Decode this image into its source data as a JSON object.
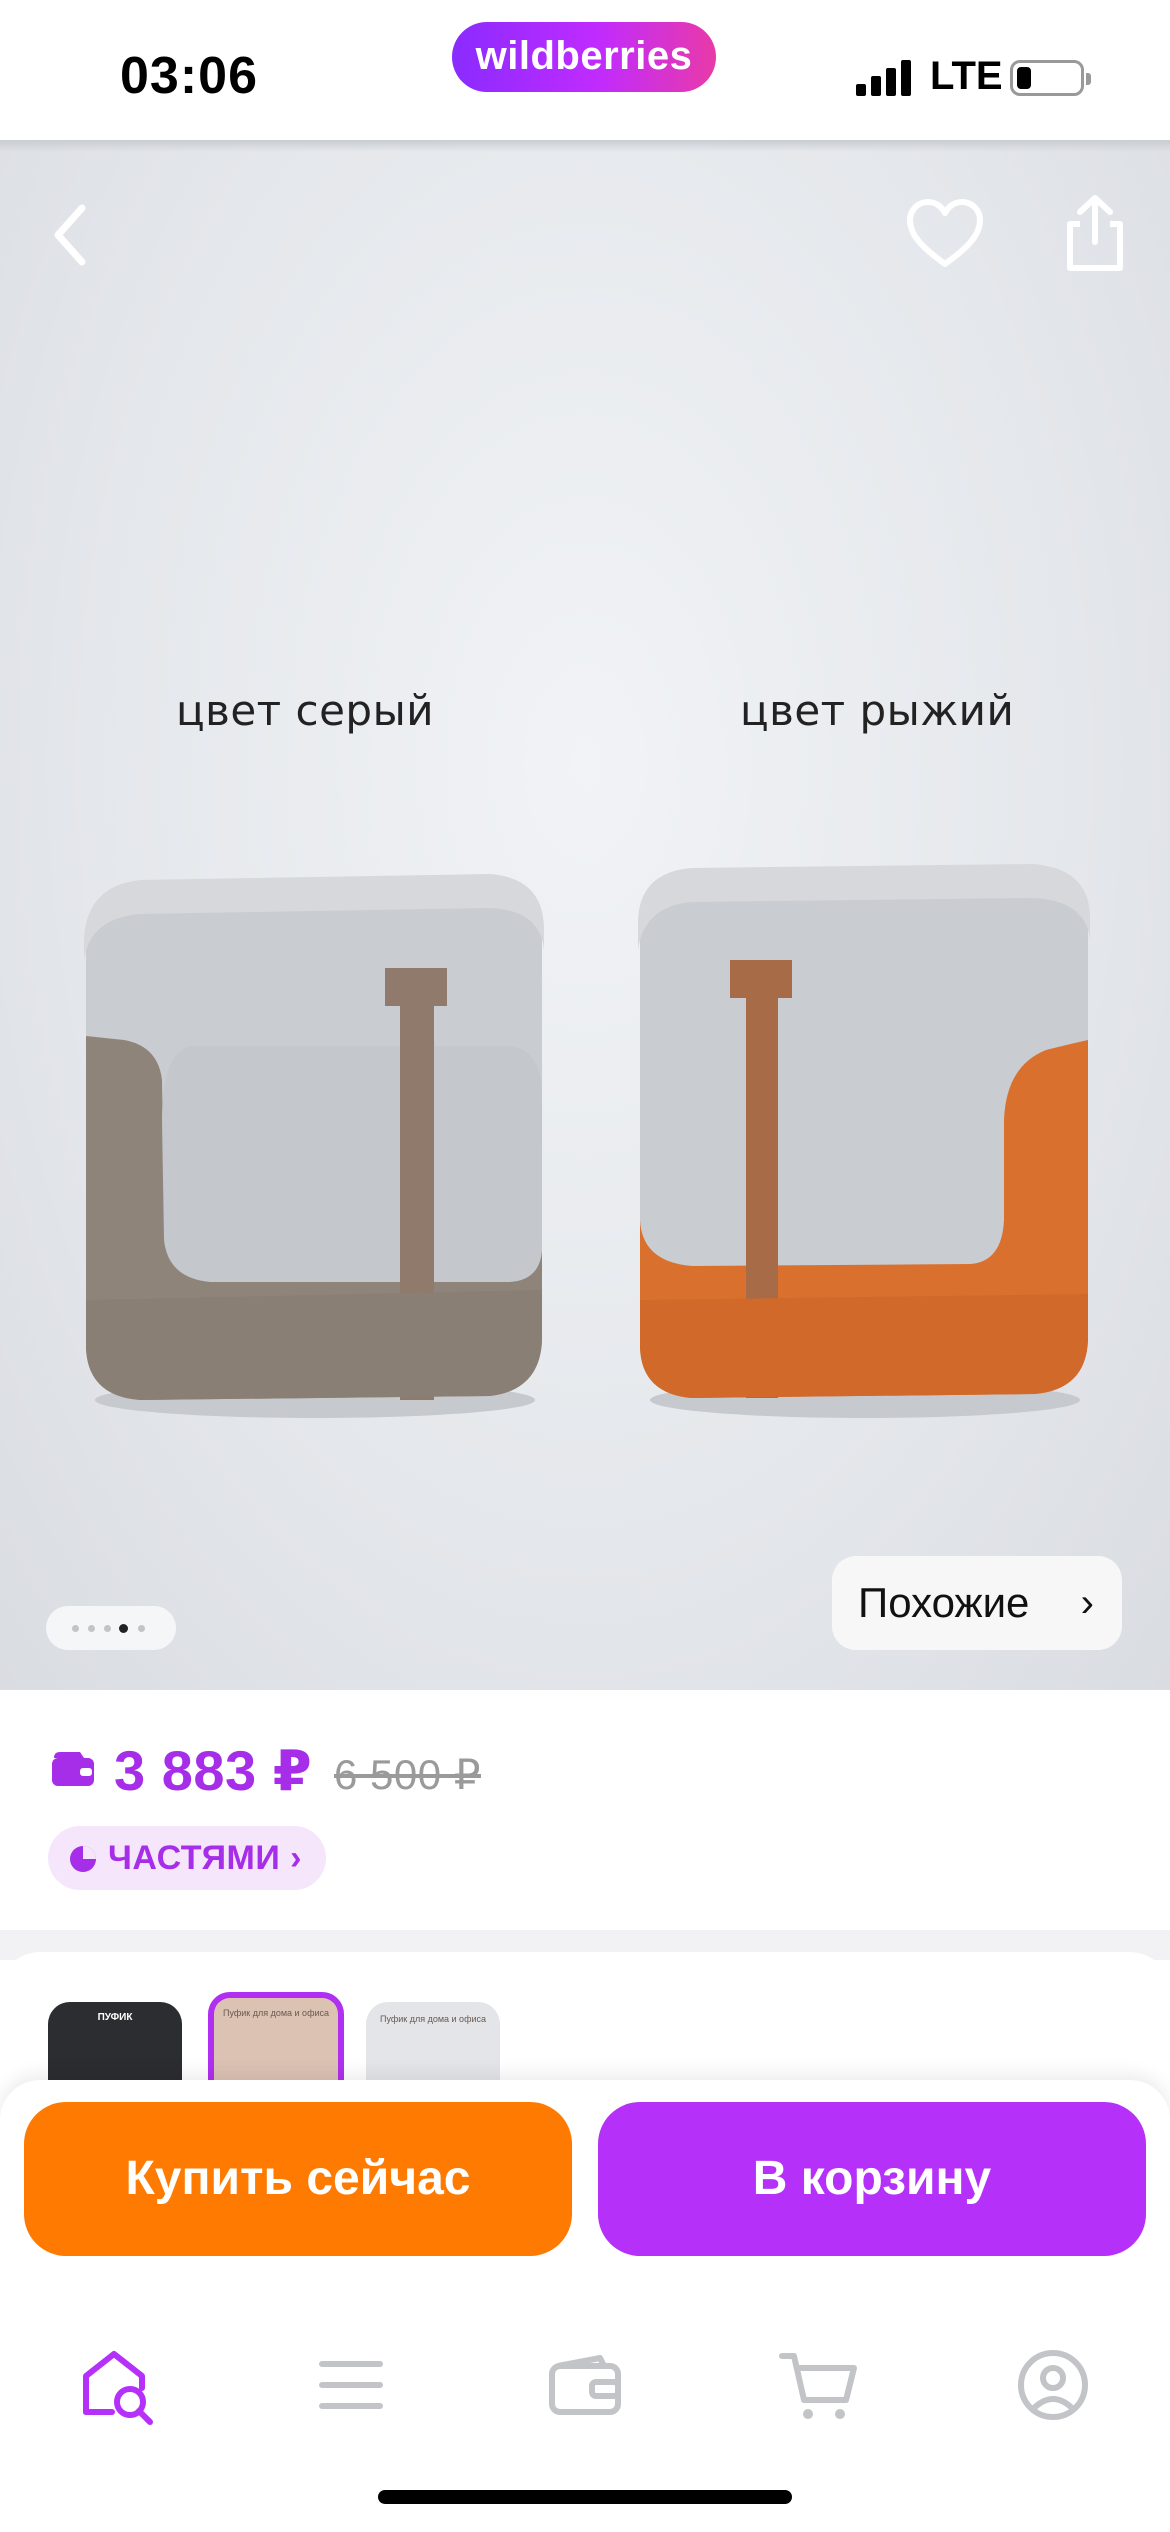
{
  "status_bar": {
    "time": "03:06",
    "brand": "wildberries",
    "network": "LTE"
  },
  "hero": {
    "color_labels": [
      "цвет серый",
      "цвет рыжий"
    ],
    "similar_label": "Похожие",
    "gallery": {
      "total": 5,
      "active_index": 3
    }
  },
  "price": {
    "current": "3 883 ₽",
    "old": "6 500 ₽",
    "installments_label": "ЧАСТЯМИ"
  },
  "thumbs": [
    {
      "caption": "ПУФИК"
    },
    {
      "caption": "Пуфик для дома и офиса"
    },
    {
      "caption": "Пуфик для дома и офиса"
    }
  ],
  "actions": {
    "buy_now": "Купить сейчас",
    "to_cart": "В корзину"
  },
  "tab_bar": {
    "items": [
      "home-search-icon",
      "menu-icon",
      "wallet-icon",
      "cart-icon",
      "profile-icon"
    ],
    "active": "home-search-icon"
  },
  "colors": {
    "brand_purple": "#b530f8",
    "price_purple": "#a62ee8",
    "buy_orange": "#ff7a00",
    "pouf_gray_leather": "#8f8479",
    "pouf_ginger_leather": "#d9702e",
    "pouf_fabric": "#c9ccd1"
  }
}
